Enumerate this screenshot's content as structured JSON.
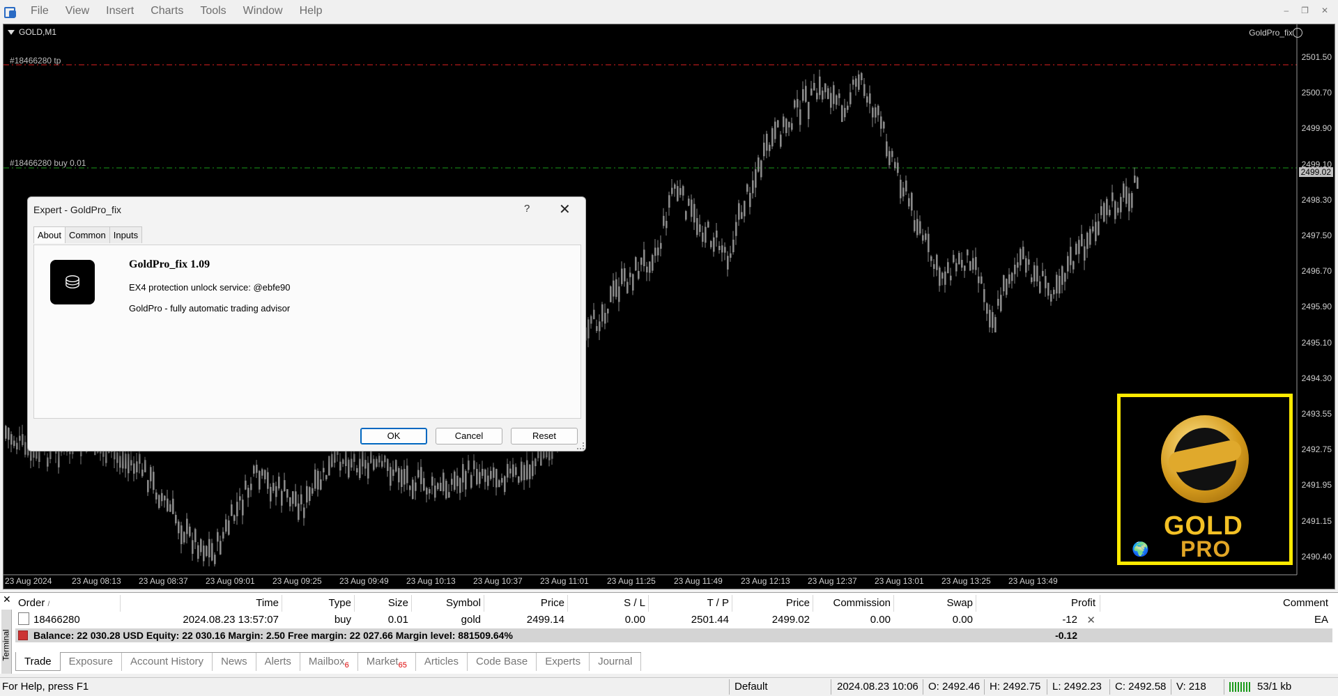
{
  "menu": {
    "items": [
      "File",
      "View",
      "Insert",
      "Charts",
      "Tools",
      "Window",
      "Help"
    ]
  },
  "chart": {
    "symbol": "GOLD,M1",
    "ea_name": "GoldPro_fix",
    "tp_label": "#18466280 tp",
    "order_label": "#18466280 buy 0.01",
    "current_price": "2499.02",
    "price_levels": [
      "2501.50",
      "2500.70",
      "2499.90",
      "2499.10",
      "2498.30",
      "2497.50",
      "2496.70",
      "2495.90",
      "2495.10",
      "2494.30",
      "2493.55",
      "2492.75",
      "2491.95",
      "2491.15",
      "2490.40"
    ],
    "time_labels": [
      "23 Aug 2024",
      "23 Aug 08:13",
      "23 Aug 08:37",
      "23 Aug 09:01",
      "23 Aug 09:25",
      "23 Aug 09:49",
      "23 Aug 10:13",
      "23 Aug 10:37",
      "23 Aug 11:01",
      "23 Aug 11:25",
      "23 Aug 11:49",
      "23 Aug 12:13",
      "23 Aug 12:37",
      "23 Aug 13:01",
      "23 Aug 13:25",
      "23 Aug 13:49"
    ],
    "colors": {
      "background": "#000000",
      "tp_line": "#e02020",
      "order_line": "#1a9a1a",
      "candles": "#8a8a8a"
    },
    "logo": {
      "word1": "GOLD",
      "word2": "PRO",
      "border_color": "#ffea00"
    }
  },
  "dialog": {
    "title": "Expert - GoldPro_fix",
    "help": "?",
    "close": "✕",
    "tabs": [
      "About",
      "Common",
      "Inputs"
    ],
    "ea_title": "GoldPro_fix 1.09",
    "line1": "EX4 protection unlock service: @ebfe90",
    "line2": "GoldPro - fully automatic trading advisor",
    "ok": "OK",
    "cancel": "Cancel",
    "reset": "Reset"
  },
  "terminal": {
    "side_label": "Terminal",
    "columns": [
      "Order",
      "Time",
      "Type",
      "Size",
      "Symbol",
      "Price",
      "S / L",
      "T / P",
      "Price",
      "Commission",
      "Swap",
      "Profit",
      "Comment"
    ],
    "order_sort_mark": "/",
    "row": {
      "order": "18466280",
      "time": "2024.08.23 13:57:07",
      "type": "buy",
      "size": "0.01",
      "symbol": "gold",
      "price": "2499.14",
      "sl": "0.00",
      "tp": "2501.44",
      "cur_price": "2499.02",
      "commission": "0.00",
      "swap": "0.00",
      "profit": "-12",
      "comment": "EA"
    },
    "balance_text": "Balance: 22 030.28 USD  Equity: 22 030.16  Margin: 2.50  Free margin: 22 027.66  Margin level: 881509.64%",
    "balance_profit": "-0.12",
    "tabs": [
      {
        "label": "Trade",
        "badge": ""
      },
      {
        "label": "Exposure",
        "badge": ""
      },
      {
        "label": "Account History",
        "badge": ""
      },
      {
        "label": "News",
        "badge": ""
      },
      {
        "label": "Alerts",
        "badge": ""
      },
      {
        "label": "Mailbox",
        "badge": "6"
      },
      {
        "label": "Market",
        "badge": "65"
      },
      {
        "label": "Articles",
        "badge": ""
      },
      {
        "label": "Code Base",
        "badge": ""
      },
      {
        "label": "Experts",
        "badge": ""
      },
      {
        "label": "Journal",
        "badge": ""
      }
    ]
  },
  "status": {
    "help": "For Help, press F1",
    "profile": "Default",
    "datetime": "2024.08.23 10:06",
    "open": "O: 2492.46",
    "high": "H: 2492.75",
    "low": "L: 2492.23",
    "close": "C: 2492.58",
    "volume": "V: 218",
    "traffic": "53/1 kb"
  }
}
